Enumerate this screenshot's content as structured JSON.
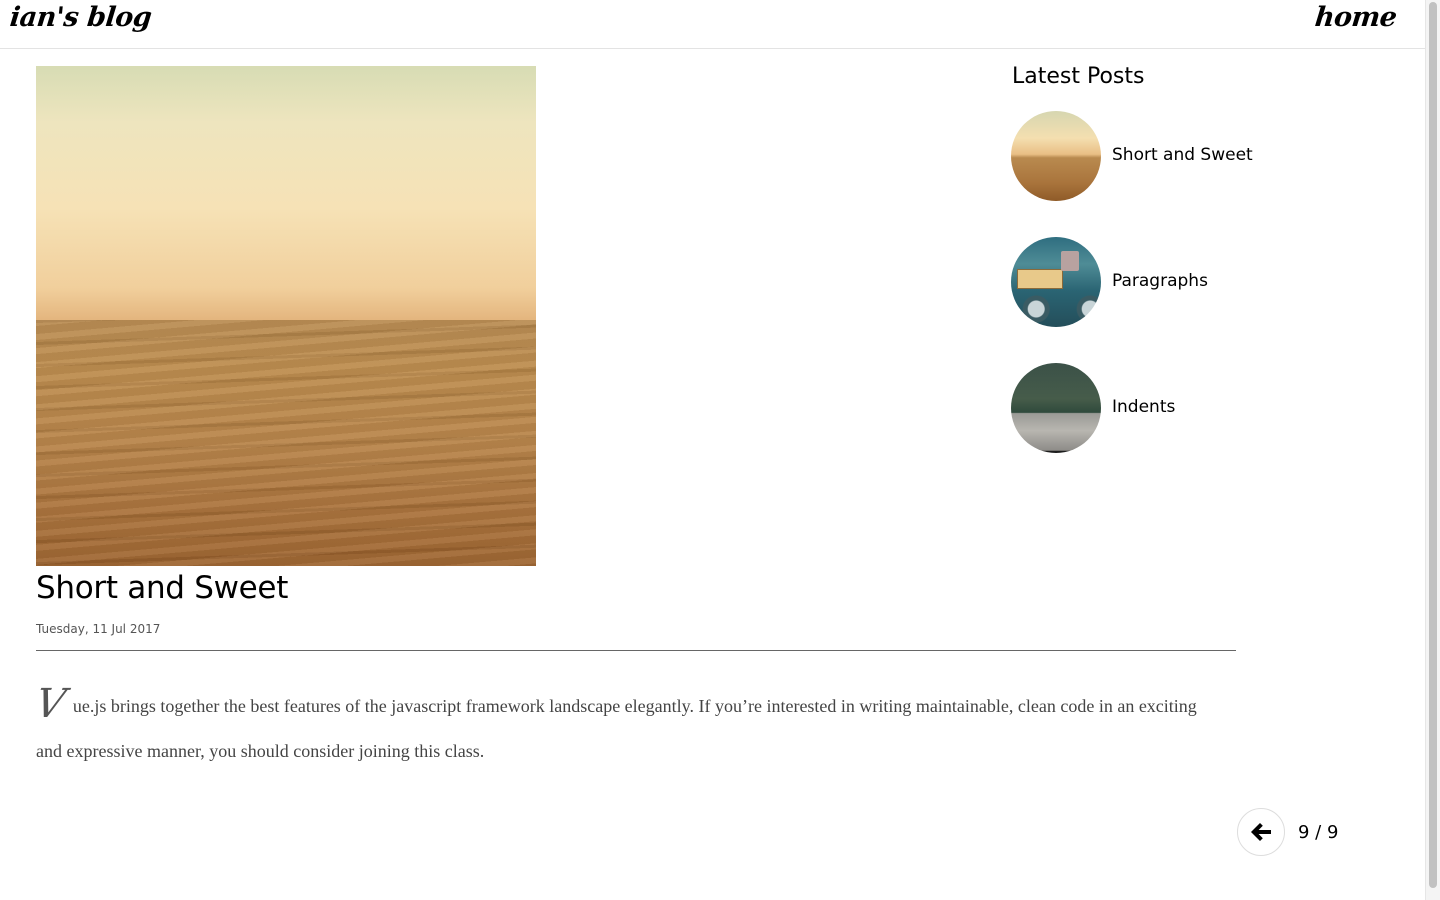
{
  "header": {
    "brand": "ian's blog",
    "nav_home": "home"
  },
  "post": {
    "title": "Short and Sweet",
    "date": "Tuesday, 11 Jul 2017",
    "drop_cap": "V",
    "body": "ue.js brings together the best features of the javascript framework landscape elegantly. If you’re interested in writing maintainable, clean code in an exciting and expressive manner, you should consider joining this class."
  },
  "sidebar": {
    "title": "Latest Posts",
    "items": [
      {
        "label": "Short and Sweet"
      },
      {
        "label": "Paragraphs"
      },
      {
        "label": "Indents"
      }
    ]
  },
  "pager": {
    "prev_icon": "arrow-left-icon",
    "count": "9 / 9"
  }
}
